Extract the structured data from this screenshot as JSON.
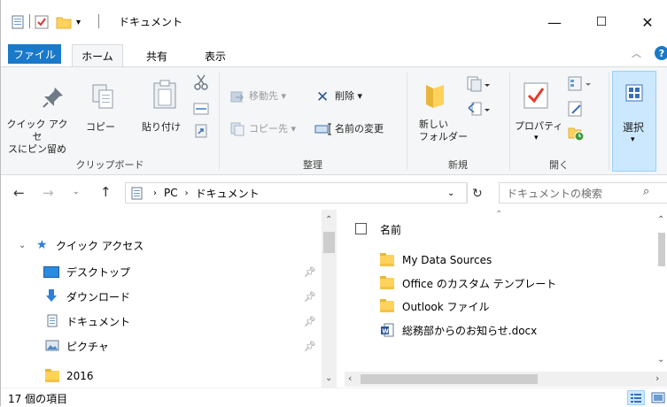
{
  "title": {
    "text": "ドキュメント",
    "minimize": "—",
    "maximize": "☐",
    "close": "✕"
  },
  "tabs": {
    "file": "ファイル",
    "home": "ホーム",
    "share": "共有",
    "view": "表示"
  },
  "ribbon": {
    "clipboard": {
      "pin_quick": "クイック アクセ\nスにピン留め",
      "pin_quick_l1": "クイック アクセ",
      "pin_quick_l2": "スにピン留め",
      "copy": "コピー",
      "paste": "貼り付け",
      "group": "クリップボード"
    },
    "organize": {
      "move_to": "移動先",
      "copy_to": "コピー先",
      "delete": "削除",
      "rename": "名前の変更",
      "group": "整理"
    },
    "new": {
      "new_folder_l1": "新しい",
      "new_folder_l2": "フォルダー",
      "group": "新規"
    },
    "open": {
      "properties": "プロパティ",
      "group": "開く"
    },
    "select": {
      "label": "選択"
    }
  },
  "address": {
    "path": [
      "PC",
      "ドキュメント"
    ],
    "search_placeholder": "ドキュメントの検索"
  },
  "nav": {
    "quick_access": "クイック アクセス",
    "items": [
      {
        "label": "デスクトップ",
        "icon": "desktop-icon",
        "pinned": true
      },
      {
        "label": "ダウンロード",
        "icon": "download-icon",
        "pinned": true
      },
      {
        "label": "ドキュメント",
        "icon": "document-icon",
        "pinned": true
      },
      {
        "label": "ピクチャ",
        "icon": "pictures-icon",
        "pinned": true
      },
      {
        "label": "2016",
        "icon": "folder-icon",
        "pinned": false
      }
    ]
  },
  "files": {
    "column_name": "名前",
    "items": [
      {
        "name": "My Data Sources",
        "type": "folder"
      },
      {
        "name": "Office のカスタム テンプレート",
        "type": "folder"
      },
      {
        "name": "Outlook ファイル",
        "type": "folder"
      },
      {
        "name": "総務部からのお知らせ.docx",
        "type": "word"
      }
    ]
  },
  "status": {
    "count": "17 個の項目"
  },
  "colors": {
    "accent": "#1979ca",
    "folder": "#ffd25c",
    "ribbon_bg": "#f5f6f7",
    "select_bg": "#cce8ff"
  }
}
